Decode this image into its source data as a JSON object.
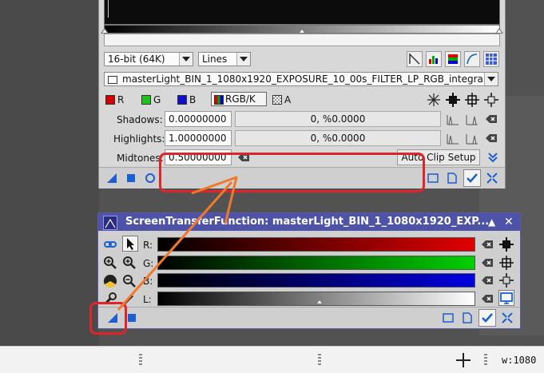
{
  "histogram": {
    "resolution_select": "16-bit (64K)",
    "mode_select": "Lines",
    "view_select": "masterLight_BIN_1_1080x1920_EXPOSURE_10_00s_FILTER_LP_RGB_integra",
    "channels": {
      "r": "R",
      "g": "G",
      "b": "B",
      "rgbk": "RGB/K",
      "a": "A"
    },
    "shadows_label": "Shadows:",
    "shadows_value": "0.00000000",
    "shadows_readout": "0, %0.0000",
    "highlights_label": "Highlights:",
    "highlights_value": "1.00000000",
    "highlights_readout": "0, %0.0000",
    "midtones_label": "Midtones:",
    "midtones_value": "0.50000000",
    "autoclip_button": "Auto Clip Setup"
  },
  "stf": {
    "title": "ScreenTransferFunction: masterLight_BIN_1_1080x1920_EXP...",
    "channels": [
      {
        "label": "R:",
        "color": "#e00000"
      },
      {
        "label": "G:",
        "color": "#00d000"
      },
      {
        "label": "B:",
        "color": "#0000e0"
      },
      {
        "label": "L:",
        "color": "#ffffff"
      }
    ]
  },
  "statusbar": {
    "width_readout": "w:1080"
  },
  "colors": {
    "annotation_red": "#e0242a",
    "annotation_orange": "#f07a2a",
    "stf_title_bg": "#4e53a8"
  }
}
